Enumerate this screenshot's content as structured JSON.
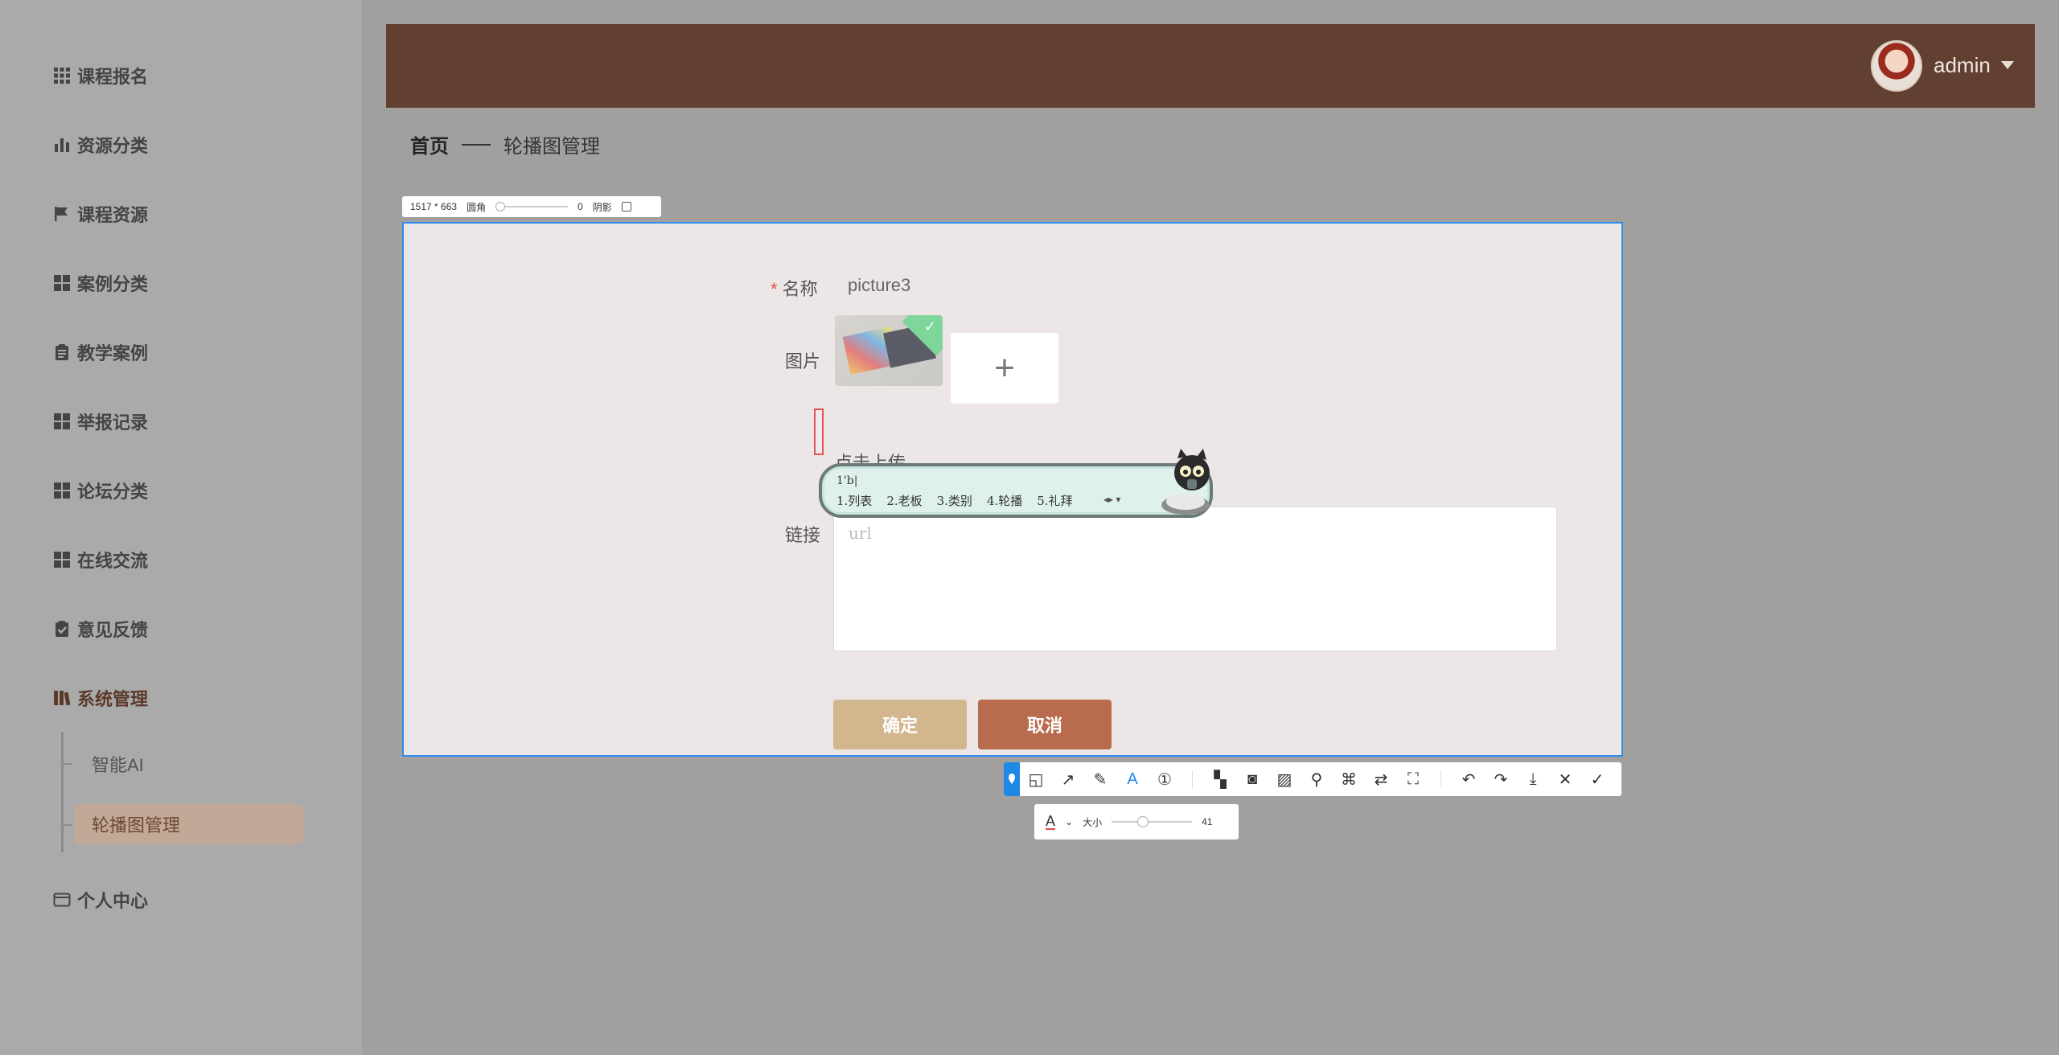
{
  "sidebar": {
    "items": [
      {
        "label": "课程报名",
        "icon": "grid-icon"
      },
      {
        "label": "资源分类",
        "icon": "bar-chart-icon"
      },
      {
        "label": "课程资源",
        "icon": "flag-icon"
      },
      {
        "label": "案例分类",
        "icon": "grid-icon"
      },
      {
        "label": "教学案例",
        "icon": "clipboard-icon"
      },
      {
        "label": "举报记录",
        "icon": "grid-icon"
      },
      {
        "label": "论坛分类",
        "icon": "grid-icon"
      },
      {
        "label": "在线交流",
        "icon": "grid-icon"
      },
      {
        "label": "意见反馈",
        "icon": "clipboard-check-icon"
      },
      {
        "label": "系统管理",
        "icon": "book-icon"
      },
      {
        "label": "个人中心",
        "icon": "wallet-icon"
      }
    ],
    "submenu": [
      {
        "label": "智能AI"
      },
      {
        "label": "轮播图管理"
      }
    ]
  },
  "header": {
    "user_name": "admin"
  },
  "breadcrumb": {
    "home": "首页",
    "current": "轮播图管理"
  },
  "shot_info": {
    "size": "1517 * 663",
    "radius_label": "圆角",
    "radius_value": "0",
    "shadow_label": "阴影"
  },
  "form": {
    "name_label": "名称",
    "name_value": "picture3",
    "image_label": "图片",
    "upload_plus": "+",
    "upload_text": "点击上传",
    "link_label": "链接",
    "link_placeholder": "url",
    "confirm_label": "确定",
    "cancel_label": "取消"
  },
  "ime": {
    "input": "1'b|",
    "candidates": [
      "1.列表",
      "2.老板",
      "3.类别",
      "4.轮播",
      "5.礼拜"
    ]
  },
  "toolbar": {
    "tools": [
      "shapes-icon",
      "arrow-icon",
      "pen-icon",
      "text-icon",
      "number-icon",
      "mosaic-icon",
      "blur-icon",
      "hatch-icon",
      "pin-icon",
      "scan-icon",
      "translate-icon",
      "ocr-icon",
      "undo-icon",
      "redo-icon",
      "download-icon",
      "close-icon",
      "check-icon"
    ]
  },
  "text_opts": {
    "font_icon": "A",
    "size_label": "大小",
    "size_value": "41"
  }
}
